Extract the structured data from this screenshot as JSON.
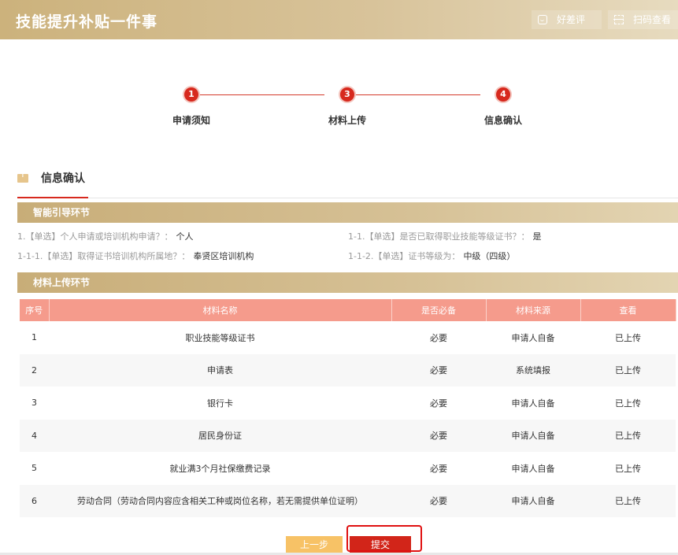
{
  "header": {
    "title": "技能提升补贴一件事",
    "review_label": "好差评",
    "scan_label": "扫码查看"
  },
  "steps": [
    {
      "num": "1",
      "label": "申请须知"
    },
    {
      "num": "3",
      "label": "材料上传"
    },
    {
      "num": "4",
      "label": "信息确认"
    }
  ],
  "section": {
    "title": "信息确认"
  },
  "guide": {
    "title": "智能引导环节",
    "items": [
      {
        "q": "1.【单选】个人申请或培训机构申请？：",
        "a": "个人"
      },
      {
        "q": "1-1.【单选】是否已取得职业技能等级证书？：",
        "a": "是"
      },
      {
        "q": "1-1-1.【单选】取得证书培训机构所属地？：",
        "a": "奉贤区培训机构"
      },
      {
        "q": "1-1-2.【单选】证书等级为：",
        "a": "中级（四级）"
      }
    ]
  },
  "materials": {
    "title": "材料上传环节",
    "columns": [
      "序号",
      "材料名称",
      "是否必备",
      "材料来源",
      "查看"
    ],
    "rows": [
      [
        "1",
        "职业技能等级证书",
        "必要",
        "申请人自备",
        "已上传"
      ],
      [
        "2",
        "申请表",
        "必要",
        "系统填报",
        "已上传"
      ],
      [
        "3",
        "银行卡",
        "必要",
        "申请人自备",
        "已上传"
      ],
      [
        "4",
        "居民身份证",
        "必要",
        "申请人自备",
        "已上传"
      ],
      [
        "5",
        "就业满3个月社保缴费记录",
        "必要",
        "申请人自备",
        "已上传"
      ],
      [
        "6",
        "劳动合同（劳动合同内容应含相关工种或岗位名称，若无需提供单位证明）",
        "必要",
        "申请人自备",
        "已上传"
      ]
    ]
  },
  "buttons": {
    "prev": "上一步",
    "submit": "提交"
  },
  "colors": {
    "accent": "#d7291e",
    "gold": "#ccb27c",
    "table_header": "#f59b8c"
  }
}
